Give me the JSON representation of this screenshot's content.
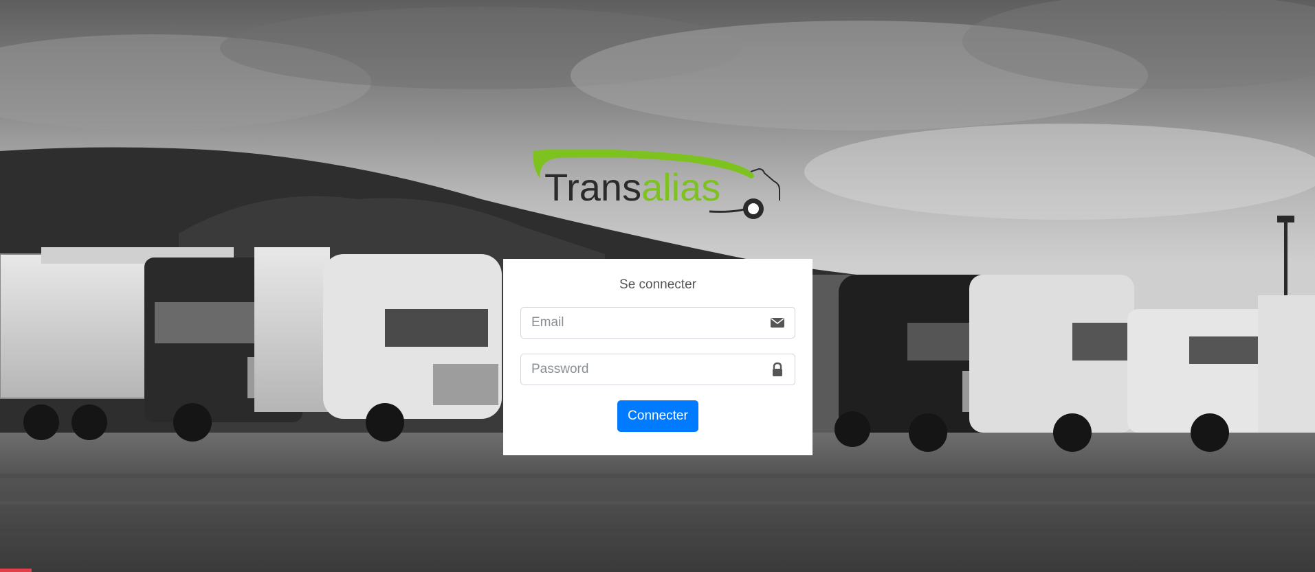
{
  "brand": {
    "name_part1": "Trans",
    "name_part2": "alias",
    "dark_color": "#2b2b2b",
    "accent_color": "#7dc21e"
  },
  "login": {
    "title": "Se connecter",
    "email_placeholder": "Email",
    "password_placeholder": "Password",
    "submit_label": "Connecter",
    "button_color": "#007bff"
  },
  "icons": {
    "email": "envelope-icon",
    "password": "lock-icon"
  }
}
